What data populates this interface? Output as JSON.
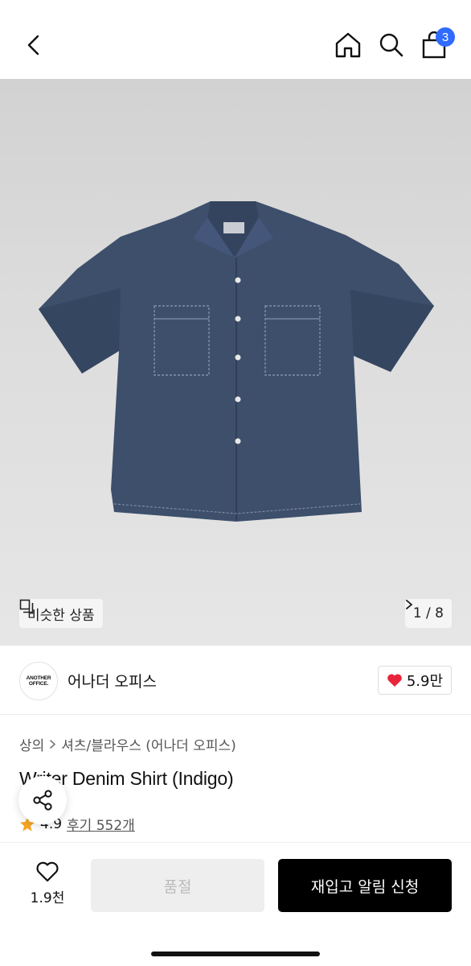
{
  "header": {
    "cart_count": "3",
    "icons": {
      "back": "chevron-left-icon",
      "home": "home-icon",
      "search": "search-icon",
      "cart": "shopping-bag-icon"
    }
  },
  "gallery": {
    "similar_label": "비슷한 상품",
    "page_indicator": "1 / 8",
    "shirt_color": "#3d4f6b"
  },
  "brand": {
    "logo_line1": "ANOTHER",
    "logo_line2": "OFFICE.",
    "name": "어나더 오피스",
    "likes": "5.9만"
  },
  "product": {
    "breadcrumb": [
      "상의",
      "셔츠/블라우스 (어나더 오피스)"
    ],
    "title": "Writer Denim Shirt (Indigo)",
    "rating": "4.9",
    "reviews": "후기 552개"
  },
  "actions": {
    "wish_count": "1.9천",
    "soldout_label": "품절",
    "restock_label": "재입고 알림 신청"
  },
  "colors": {
    "accent": "#2f6bff",
    "heart": "#e8253a",
    "star": "#f5a623"
  }
}
